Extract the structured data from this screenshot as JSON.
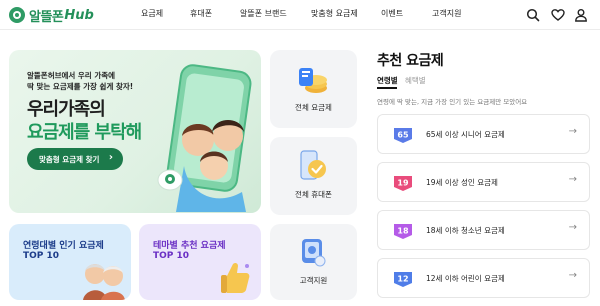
{
  "header": {
    "logo_text": "알뜰폰",
    "logo_hub": "Hub",
    "nav": [
      "요금제",
      "휴대폰",
      "알뜰폰 브랜드",
      "맞춤형 요금제",
      "이벤트",
      "고객지원"
    ]
  },
  "banner": {
    "sub_line1": "알뜰폰허브에서 우리 가족에",
    "sub_line2": "딱 맞는 요금제를 가장 쉽게 찾자!",
    "title1": "우리가족의",
    "title2": "요금제를 부탁해",
    "button_label": "맞춤형 요금제 찾기"
  },
  "middle": {
    "all_plans_label": "전체 요금제",
    "all_phones_label": "전체 휴대폰",
    "support_label": "고객지원"
  },
  "cards": {
    "age_title": "연령대별 인기 요금제",
    "age_top": "TOP 10",
    "theme_title": "테마별 추천 요금제",
    "theme_top": "TOP 10"
  },
  "recommend": {
    "title": "추천 요금제",
    "tab_age": "연령별",
    "tab_benefit": "혜택별",
    "description": "연령에 딱 맞는, 지금 가장 인기 있는 요금제만 모았어요",
    "plans": [
      {
        "badge": "65",
        "label": "65세 이상 시니어 요금제"
      },
      {
        "badge": "19",
        "label": "19세 이상 성인 요금제"
      },
      {
        "badge": "18",
        "label": "18세 이하 청소년 요금제"
      },
      {
        "badge": "12",
        "label": "12세 이하 어린이 요금제"
      }
    ]
  },
  "colors": {
    "brand_green": "#24905a",
    "button_green": "#1c7a4b",
    "badge_blue": "#3b5fe0",
    "badge_pink": "#e94c7c"
  }
}
